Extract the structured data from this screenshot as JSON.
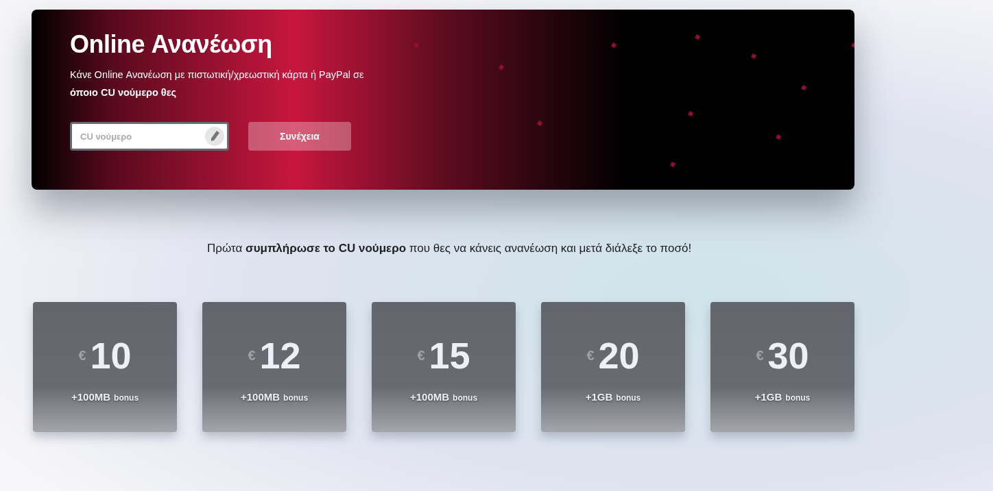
{
  "banner": {
    "title": "Online Ανανέωση",
    "subtitle": "Κάνε Online Ανανέωση με πιστωτική/χρεωστική κάρτα ή PayPal σε **όποιο CU νούμερο θες**",
    "input": {
      "placeholder": "CU νούμερο"
    },
    "button": {
      "label": "Συνέχεια",
      "disabled": true
    }
  },
  "instruction": "Πρώτα **συμπλήρωσε το CU νούμερο** που θες να κάνεις ανανέωση και μετά διάλεξε το ποσό!",
  "amounts": [
    {
      "currency": "€",
      "value": "10",
      "bonus": "+100MB",
      "bonus_label": "bonus"
    },
    {
      "currency": "€",
      "value": "12",
      "bonus": "+100MB",
      "bonus_label": "bonus"
    },
    {
      "currency": "€",
      "value": "15",
      "bonus": "+100MB",
      "bonus_label": "bonus"
    },
    {
      "currency": "€",
      "value": "20",
      "bonus": "+1GB",
      "bonus_label": "bonus"
    },
    {
      "currency": "€",
      "value": "30",
      "bonus": "+1GB",
      "bonus_label": "bonus"
    }
  ]
}
